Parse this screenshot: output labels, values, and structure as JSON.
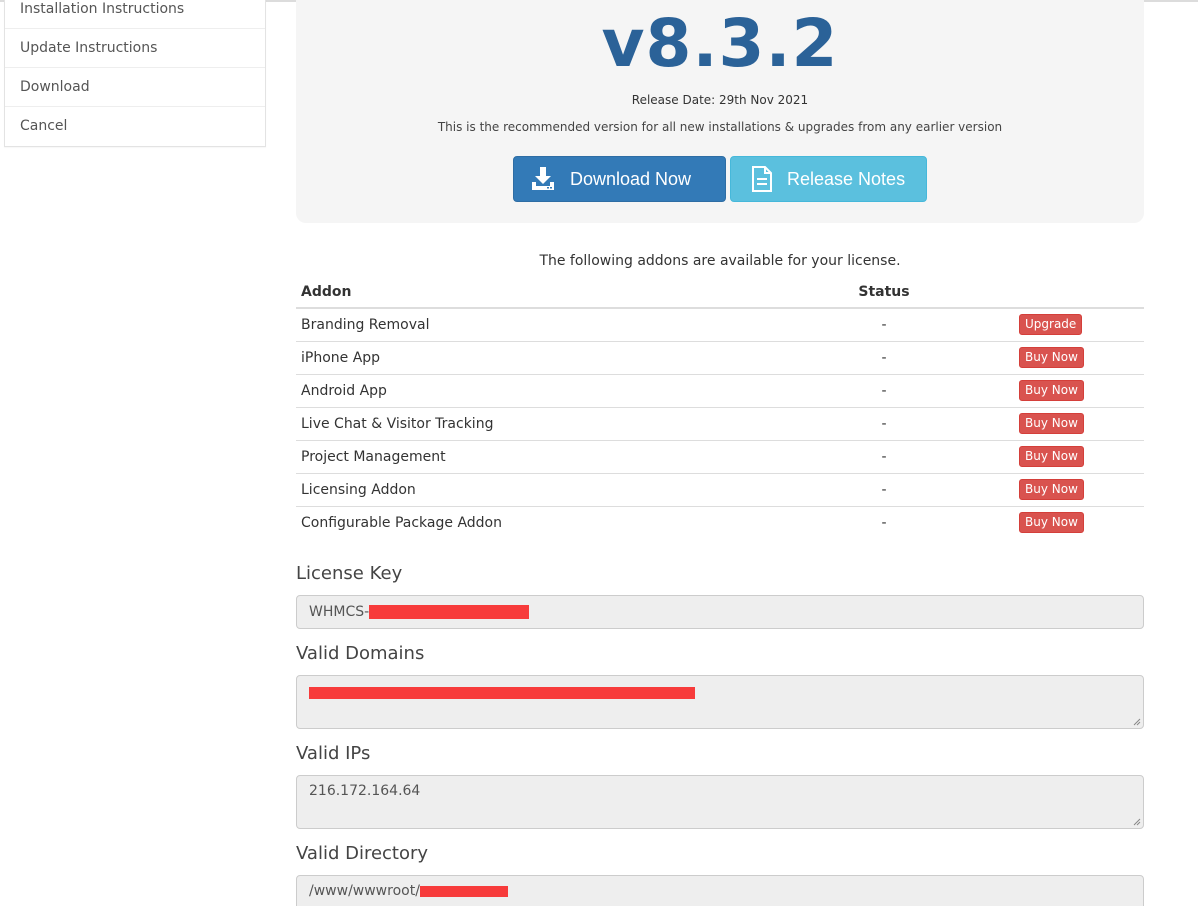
{
  "sidebar": {
    "items": [
      {
        "label": "Installation Instructions"
      },
      {
        "label": "Update Instructions"
      },
      {
        "label": "Download"
      },
      {
        "label": "Cancel"
      }
    ]
  },
  "release": {
    "version": "v8.3.2",
    "date_text": "Release Date: 29th Nov 2021",
    "recommendation": "This is the recommended version for all new installations & upgrades from any earlier version",
    "download_label": "Download Now",
    "notes_label": "Release Notes"
  },
  "addons": {
    "intro": "The following addons are available for your license.",
    "headers": {
      "addon": "Addon",
      "status": "Status"
    },
    "rows": [
      {
        "name": "Branding Removal",
        "status": "-",
        "action": "Upgrade"
      },
      {
        "name": "iPhone App",
        "status": "-",
        "action": "Buy Now"
      },
      {
        "name": "Android App",
        "status": "-",
        "action": "Buy Now"
      },
      {
        "name": "Live Chat & Visitor Tracking",
        "status": "-",
        "action": "Buy Now"
      },
      {
        "name": "Project Management",
        "status": "-",
        "action": "Buy Now"
      },
      {
        "name": "Licensing Addon",
        "status": "-",
        "action": "Buy Now"
      },
      {
        "name": "Configurable Package Addon",
        "status": "-",
        "action": "Buy Now"
      }
    ]
  },
  "license": {
    "key_label": "License Key",
    "key_value_prefix": "WHMCS-",
    "domains_label": "Valid Domains",
    "ips_label": "Valid IPs",
    "ips_value": "216.172.164.64",
    "directory_label": "Valid Directory",
    "directory_value_prefix": "/www/wwwroot/"
  },
  "colors": {
    "primary": "#337ab7",
    "info": "#5bc0de",
    "danger": "#d9534f",
    "version_text": "#2b6298",
    "redaction": "#f73b3b"
  }
}
